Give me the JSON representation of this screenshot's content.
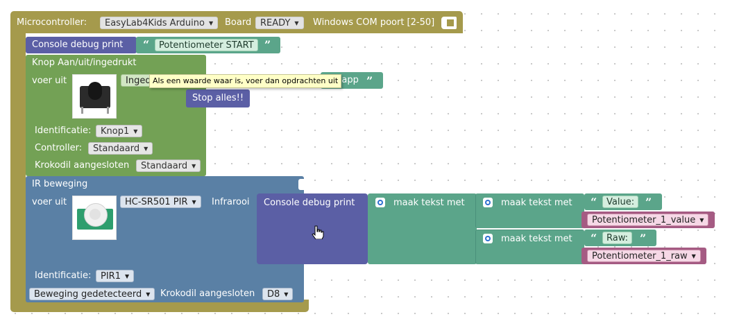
{
  "colors": {
    "microcontroller_block": "#a59a4c",
    "console_block": "#5b5fa5",
    "button_block": "#73a155",
    "ir_block": "#5a80a5",
    "text_block": "#5ba58a",
    "variable_block": "#a55b83",
    "tooltip_bg": "#ffffc7"
  },
  "microcontroller": {
    "label": "Microcontroller:",
    "board_value": "EasyLab4Kids Arduino",
    "board_label": "Board",
    "status_value": "READY",
    "port_text": "Windows COM poort [2-50]"
  },
  "console_print_1": {
    "label": "Console debug print",
    "open_quote": "“",
    "text": "Potentiometer START",
    "close_quote": "”"
  },
  "button_block": {
    "title": "Knop Aan/uit/ingedrukt",
    "do_label": "voer uit",
    "state_truncated": "Inged",
    "image_icon": "push-button-icon",
    "identification_label": "Identificatie:",
    "identification_value": "Knop1",
    "controller_label": "Controller:",
    "controller_value": "Standaard",
    "clip_label": "Krokodil aangesloten",
    "clip_value": "Standaard"
  },
  "stop_app": {
    "truncated_text": "p app",
    "close_quote": "”"
  },
  "stop_all": {
    "label": "Stop alles!!"
  },
  "tooltip": {
    "text": "Als een waarde waar is, voer dan opdrachten uit"
  },
  "ir_block": {
    "title": "IR beweging",
    "do_label": "voer uit",
    "image_icon": "pir-sensor-icon",
    "sensor_value": "HC-SR501 PIR",
    "sensor_label": "Infrarooi",
    "identification_label": "Identificatie:",
    "identification_value": "PIR1",
    "event_value": "Beweging gedetecteerd",
    "clip_label": "Krokodil aangesloten",
    "pin_value": "D8"
  },
  "console_print_2": {
    "label": "Console debug print",
    "cursor_icon": "hand-cursor-icon"
  },
  "make_text_outer": {
    "label": "maak tekst met"
  },
  "make_text_value": {
    "label": "maak tekst met",
    "open_quote": "“",
    "text": "Value:",
    "close_quote": "”",
    "variable": "Potentiometer_1_value"
  },
  "make_text_raw": {
    "label": "maak tekst met",
    "open_quote": "“",
    "text": "Raw:",
    "close_quote": "”",
    "variable": "Potentiometer_1_raw"
  }
}
